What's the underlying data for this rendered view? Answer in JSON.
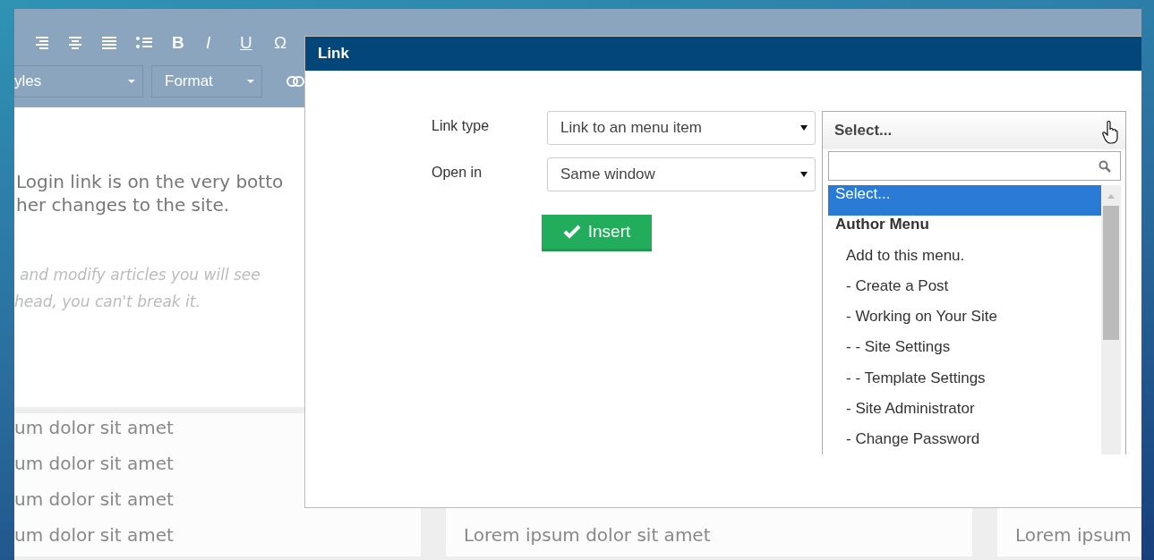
{
  "toolbar": {
    "format_buttons": [
      "B",
      "I",
      "U",
      "Ω"
    ],
    "selects": [
      {
        "label": "yles"
      },
      {
        "label": "Format"
      }
    ]
  },
  "content": {
    "paragraph": [
      "Login link is on the very botto",
      "her changes to the site."
    ],
    "note": [
      "and modify articles you will see",
      "head, you can't break it."
    ]
  },
  "cards": [
    {
      "lines": [
        "um dolor sit amet",
        "um dolor sit amet",
        "um dolor sit amet",
        "um dolor sit amet"
      ]
    },
    {
      "lines": [
        "Lorem ipsum dolor sit amet"
      ]
    },
    {
      "lines": [
        "Lorem ipsum"
      ]
    }
  ],
  "dialog": {
    "title": "Link",
    "fields": [
      {
        "label": "Link type",
        "value": "Link to an menu item"
      },
      {
        "label": "Open in",
        "value": "Same window"
      }
    ],
    "insert_button": "Insert",
    "dropdown": {
      "value": "Select...",
      "options": [
        {
          "label": "Select...",
          "kind": "option",
          "selected": true
        },
        {
          "label": "Author Menu",
          "kind": "group",
          "selected": false
        },
        {
          "label": "Add to this menu.",
          "kind": "option",
          "selected": false
        },
        {
          "label": "- Create a Post",
          "kind": "option",
          "selected": false
        },
        {
          "label": "- Working on Your Site",
          "kind": "option",
          "selected": false
        },
        {
          "label": "- - Site Settings",
          "kind": "option",
          "selected": false
        },
        {
          "label": "- - Template Settings",
          "kind": "option",
          "selected": false
        },
        {
          "label": "- Site Administrator",
          "kind": "option",
          "selected": false
        },
        {
          "label": "- Change Password",
          "kind": "option",
          "selected": false
        }
      ]
    }
  }
}
